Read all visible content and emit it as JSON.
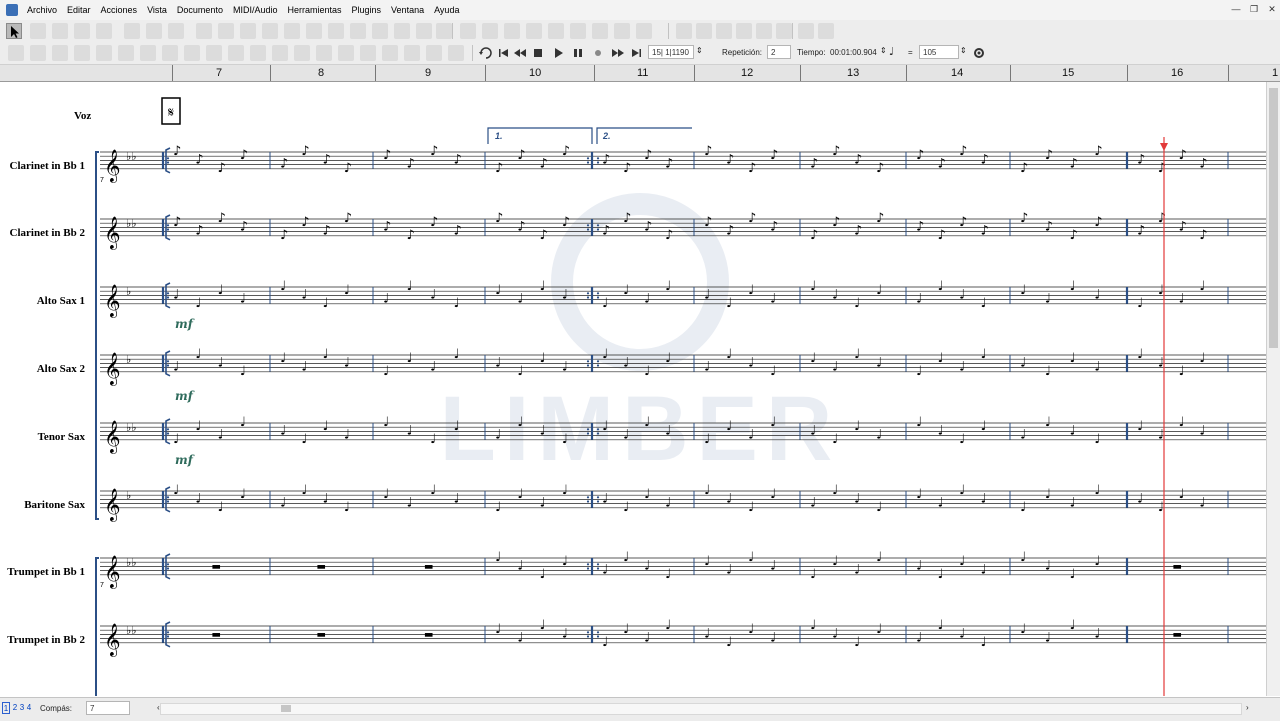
{
  "menubar": {
    "items": [
      "Archivo",
      "Editar",
      "Acciones",
      "Vista",
      "Documento",
      "MIDI/Audio",
      "Herramientas",
      "Plugins",
      "Ventana",
      "Ayuda"
    ]
  },
  "window_controls": [
    "—",
    "❐",
    "✕"
  ],
  "transport": {
    "position": "15| 1|1190",
    "repeat_label": "Repetición:",
    "repeat_value": "2",
    "tempo_label": "Tiempo:",
    "time": "00:01:00.904",
    "equals": "=",
    "bpm": "105"
  },
  "ruler": {
    "measures": [
      "7",
      "8",
      "9",
      "10",
      "11",
      "12",
      "13",
      "14",
      "15",
      "16",
      "1"
    ]
  },
  "score": {
    "voz_label": "Voz",
    "instruments": [
      "Clarinet in Bb 1",
      "Clarinet in Bb 2",
      "Alto Sax 1",
      "Alto Sax 2",
      "Tenor Sax",
      "Baritone Sax",
      "Trumpet in Bb 1",
      "Trumpet in Bb 2"
    ],
    "volta1": "1.",
    "volta2": "2.",
    "dynamic": "mf",
    "clef_small": "7",
    "watermark": "LIMBER"
  },
  "statusbar": {
    "pages": [
      "1",
      "2",
      "3",
      "4"
    ],
    "compas_label": "Compás:",
    "compas_value": "7"
  },
  "colors": {
    "barline": "#2b4f86",
    "playhead": "#e23a3a",
    "dynamic": "#2f6b5c",
    "watermark": "#e7ebf1"
  },
  "icons": {
    "toolbar1": [
      "select-arrow-icon",
      "lasso-icon",
      "note-tool-icon",
      "chord-tool-icon",
      "rest-tool-icon",
      "text-tool-icon",
      "hand-icon",
      "zoom-icon"
    ]
  }
}
